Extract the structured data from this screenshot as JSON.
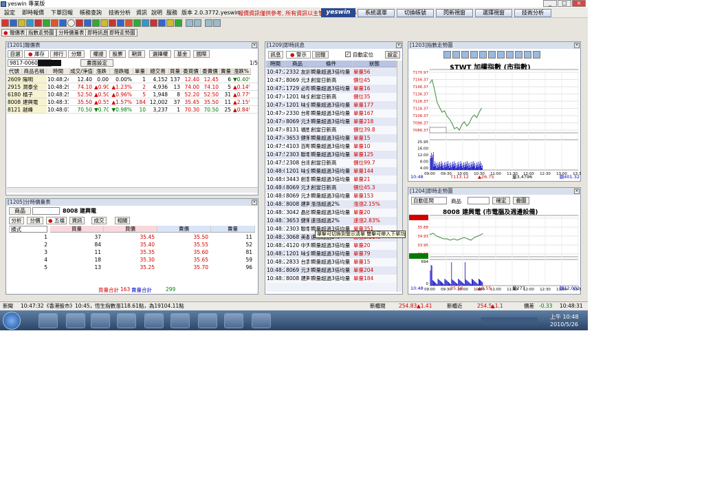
{
  "window": {
    "title": "yeswin 專業版"
  },
  "menubar": {
    "items": [
      "設定",
      "即時報價",
      "下單回報",
      "帳務查詢",
      "技術分析",
      "資訊",
      "說明",
      "服務",
      "版本 2.0.3772.yeswin"
    ],
    "notice": "報價資訊僅供參考, 所有資訊以主管機關公告為準",
    "brand": "yeswin",
    "buttons": [
      "系統選單",
      "切換帳號",
      "閃新視窗",
      "選擇視窗",
      "技術分析"
    ]
  },
  "window_tabs": [
    "報價表",
    "指數走勢圖",
    "分時價量表",
    "即時訊息",
    "即時走勢圖"
  ],
  "quote_panel": {
    "title": "[1201]報價表",
    "tabs": [
      "自選",
      "庫存",
      "排行",
      "分類",
      "權證",
      "股票",
      "期貨",
      "選擇權",
      "基金",
      "國際"
    ],
    "account": "9817-0060419",
    "button": "畫面設定",
    "page": "1/5",
    "columns": [
      "代號",
      "商品名稱",
      "時間",
      "成交/淨值",
      "漲跌",
      "漲跌幅",
      "單量",
      "總交易",
      "買量",
      "委買價",
      "委賣價",
      "賣量",
      "漲跌%"
    ],
    "rows": [
      [
        "2609",
        "陽明",
        "10:48:24",
        "12.40",
        "0.00",
        "0.00%",
        "1",
        "4,152",
        "137",
        "12.40",
        "12.45",
        "6",
        "▼0.40%"
      ],
      [
        "2915",
        "潤泰全",
        "10:48:29",
        "74.10",
        "▲0.90",
        "▲1.23%",
        "2",
        "4,936",
        "13",
        "74.00",
        "74.10",
        "5",
        "▲0.14%"
      ],
      [
        "6180",
        "橘子",
        "10:48:25",
        "52.50",
        "▲0.50",
        "▲0.96%",
        "5",
        "1,948",
        "8",
        "52.20",
        "52.50",
        "31",
        "▲0.77%"
      ],
      [
        "8008",
        "建興電",
        "10:48:31",
        "35.50",
        "▲0.55",
        "▲1.57%",
        "184",
        "12,002",
        "37",
        "35.45",
        "35.50",
        "11",
        "▲2.15%"
      ],
      [
        "8121",
        "越峰",
        "10:48:07",
        "70.50",
        "▼0.70",
        "▼0.98%",
        "10",
        "3,237",
        "1",
        "70.30",
        "70.50",
        "25",
        "▲0.84%"
      ]
    ]
  },
  "depth_panel": {
    "title": "[1205]分時價量表",
    "product_label": "商品",
    "product": "8008 建興電",
    "tabs": [
      "分析",
      "分價",
      "五檔",
      "資訊",
      "成交",
      "相關"
    ],
    "mode": "横式",
    "columns": [
      "",
      "買量",
      "買價",
      "賣價",
      "賣量"
    ],
    "rows": [
      [
        "1",
        "37",
        "35.45",
        "35.50",
        "11"
      ],
      [
        "2",
        "84",
        "35.40",
        "35.55",
        "52"
      ],
      [
        "3",
        "11",
        "35.35",
        "35.60",
        "81"
      ],
      [
        "4",
        "18",
        "35.30",
        "35.65",
        "59"
      ],
      [
        "5",
        "13",
        "35.25",
        "35.70",
        "96"
      ]
    ],
    "buy_total_label": "買量合計",
    "buy_total": "163",
    "sell_total_label": "賣量合計",
    "sell_total": "299"
  },
  "news_panel": {
    "title": "[1209]即時訊息",
    "tabs": [
      "訊息",
      "警示",
      "回報"
    ],
    "auto_label": "自動定位",
    "setting": "設定",
    "columns": [
      "時間",
      "商品",
      "條件",
      "狀態"
    ],
    "rows": [
      [
        "10:47:23",
        "2332 友訊",
        "瞬量超過3倍均量",
        "單量56"
      ],
      [
        "10:47:25",
        "8069 元太",
        "創當日新高",
        "價位45"
      ],
      [
        "10:47:29",
        "1729 必翔",
        "瞬量超過3倍均量",
        "單量16"
      ],
      [
        "10:47:42",
        "1201 味全",
        "創當日新高",
        "價位35"
      ],
      [
        "10:47:42",
        "1201 味全",
        "瞬量超過3倍均量",
        "單量177"
      ],
      [
        "10:47:44",
        "2330 台積電",
        "瞬量超過3倍均量",
        "單量167"
      ],
      [
        "10:47:45",
        "8069 元太",
        "瞬量超過3倍均量",
        "單量218"
      ],
      [
        "10:47:49",
        "8131 福懋科",
        "創當日新高",
        "價位39.8"
      ],
      [
        "10:47:49",
        "3653 健策",
        "瞬量超過3倍均量",
        "單量15"
      ],
      [
        "10:47:50",
        "4103 百略",
        "瞬量超過3倍均量",
        "單量10"
      ],
      [
        "10:47:59",
        "2303 聯電",
        "瞬量超過3倍均量",
        "單量125"
      ],
      [
        "10:47:59",
        "2308 台達電",
        "創當日新高",
        "價位99.7"
      ],
      [
        "10:48:00",
        "1201 味全",
        "瞬量超過3倍均量",
        "單量144"
      ],
      [
        "10:48:04",
        "3443 創意",
        "瞬量超過3倍均量",
        "單量21"
      ],
      [
        "10:48:05",
        "8069 元太",
        "創當日新高",
        "價位45.3"
      ],
      [
        "10:48:05",
        "8069 元太",
        "瞬量超過3倍均量",
        "單量153"
      ],
      [
        "10:48:10",
        "8008 建興電",
        "漲漲超過2%",
        "漲漲2.15%"
      ],
      [
        "10:48:11",
        "3042 晶技",
        "瞬量超過3倍均量",
        "單量20"
      ],
      [
        "10:48:13",
        "3653 健策",
        "速漲超過2%",
        "速漲2.83%"
      ],
      [
        "10:48:19",
        "2303 聯電",
        "瞬量超過3倍均量",
        "單量351"
      ],
      [
        "10:48:20",
        "3068 美磊",
        "速漲超過2%",
        "速漲2.11%"
      ],
      [
        "10:48:21",
        "4120 中天",
        "瞬量超過3倍均量",
        "單量20"
      ],
      [
        "10:48:22",
        "1201 味全",
        "瞬量超過3倍均量",
        "單量79"
      ],
      [
        "10:48:23",
        "2833 台壽保",
        "瞬量超過3倍均量",
        "單量15"
      ],
      [
        "10:48:26",
        "8069 元太",
        "瞬量超過3倍均量",
        "單量204"
      ],
      [
        "10:48:31",
        "8008 建興電",
        "瞬量超過3倍均量",
        "單量184"
      ]
    ],
    "tooltip": "單擊可切換到警示清單 雙擊可帶入下單功能"
  },
  "index_chart": {
    "title": "[1203]指數走勢圖",
    "heading": "$TWT 加權指數 (市指數)",
    "y_ticks": [
      "7170.97",
      "7156.37",
      "7146.37",
      "7136.37",
      "7126.37",
      "7116.37",
      "7106.37",
      "7096.37",
      "7086.37"
    ],
    "vol_ticks": [
      "25.95",
      "16.00",
      "12.00",
      "8.00",
      "4.00"
    ],
    "x_ticks": [
      "09:00",
      "09:30",
      "10:00",
      "10:30",
      "11:00",
      "11:30",
      "12:00",
      "12:30",
      "13:00",
      "13:30"
    ],
    "footer": [
      "10:48",
      "7113.12",
      "▲26.75",
      "量3,4796",
      "額401.32"
    ]
  },
  "stock_chart": {
    "title": "[1204]即時走勢圖",
    "mode": "自動區間",
    "product_label": "商品",
    "confirm": "確定",
    "overlay": "疊圖",
    "heading": "8008 建興電 (市電腦及週邊設備)",
    "y_ticks": [
      "37.35",
      "35.88",
      "34.93",
      "33.95",
      "32.55"
    ],
    "vol_ticks": [
      "694",
      "0"
    ],
    "x_ticks": [
      "09:00",
      "09:30",
      "10:00",
      "10:30",
      "11:00",
      "11:30",
      "12:00",
      "12:30",
      "13:00",
      "13:30"
    ],
    "footer": [
      "10:48",
      "35.50",
      "▲0.55",
      "量277",
      "額12,002"
    ]
  },
  "statusbar": {
    "label": "新聞",
    "time": "10:47:32",
    "news": "《香港股市》10:45，恆生指數漲118.61點，為19104.11點",
    "stat1_label": "新櫃現",
    "stat1_value": "254.83",
    "stat1_change": "▲1.41",
    "stat2_label": "新櫃近",
    "stat2_value": "254.5",
    "stat2_change": "▲1.1",
    "stat3_label": "價差",
    "stat3_value": "-0.33",
    "clock": "10:48:31"
  },
  "taskbar": {
    "time": "上午 10:48",
    "date": "2010/5/26"
  },
  "colors": {
    "up": "#d00000",
    "down": "#007a00",
    "accent": "#2a4a90"
  }
}
